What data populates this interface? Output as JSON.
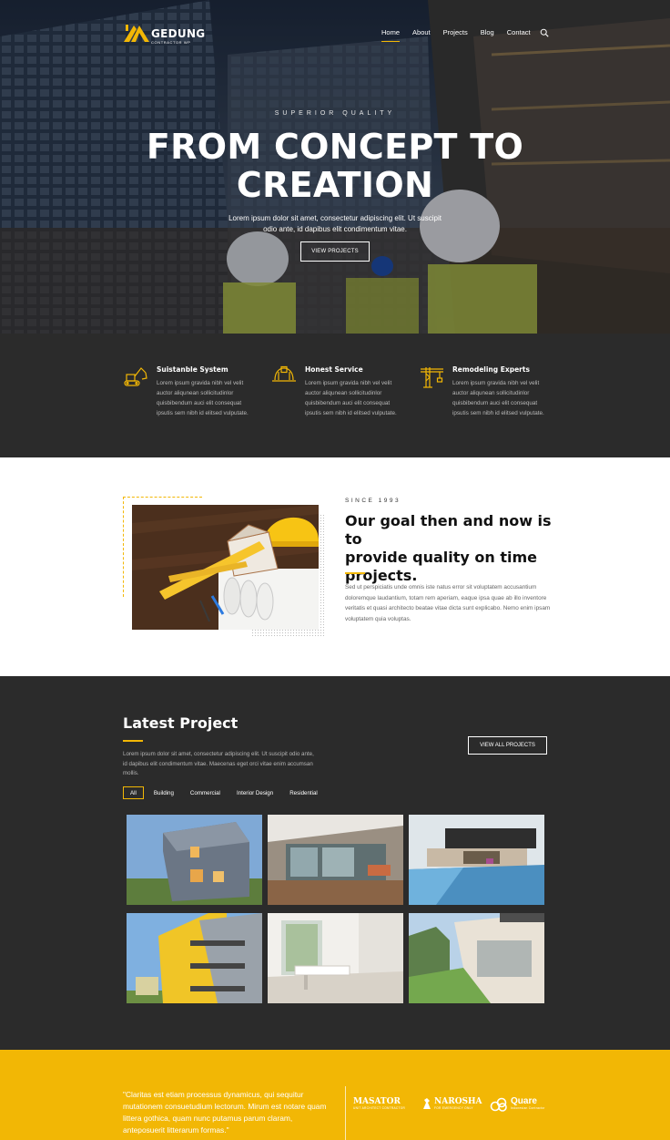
{
  "brand": {
    "name": "GEDUNG",
    "tagline": "CONTRACTOR WP",
    "accent_color": "#f2b705",
    "dark_color": "#2b2b2b"
  },
  "nav": {
    "items": [
      "Home",
      "About",
      "Projects",
      "Blog",
      "Contact"
    ],
    "active": "Home",
    "search_icon": "search-icon"
  },
  "hero": {
    "eyebrow": "SUPERIOR QUALITY",
    "headline_line1": "FROM CONCEPT TO",
    "headline_line2": "CREATION",
    "lead": "Lorem ipsum dolor sit amet, consectetur adipiscing elit. Ut suscipit odio ante, id dapibus elit condimentum vitae.",
    "button": "VIEW PROJECTS"
  },
  "features": [
    {
      "icon": "excavator-icon",
      "title": "Suistanble System",
      "text": "Lorem ipsum gravida nibh vel velit auctor aliqunean sollicitudinlor quisbibendum auci elit consequat ipsutis sem nibh id elitsed vulputate."
    },
    {
      "icon": "hard-hat-icon",
      "title": "Honest Service",
      "text": "Lorem ipsum gravida nibh vel velit auctor aliqunean sollicitudinlor quisbibendum auci elit consequat ipsutis sem nibh id elitsed vulputate."
    },
    {
      "icon": "crane-icon",
      "title": "Remodeling Experts",
      "text": "Lorem ipsum gravida nibh vel velit auctor aliqunean sollicitudinlor quisbibendum auci elit consequat ipsutis sem nibh id elitsed vulputate."
    }
  ],
  "about": {
    "since": "SINCE 1993",
    "title_line1": "Our goal then and now is to",
    "title_line2": "provide quality on time",
    "title_line3": "projects.",
    "text": "Sed ut perspiciatis unde omnis iste natus error sit voluptatem accusantium doloremque laudantium, totam rem aperiam, eaque ipsa quae ab illo inventore veritatis et quasi architecto beatae vitae dicta sunt explicabo. Nemo enim ipsam voluptatem quia voluptas."
  },
  "projects": {
    "title": "Latest Project",
    "description": "Lorem ipsum dolor sit amet, consectetur adipiscing elit. Ut suscipit odio ante, id dapibus elit condimentum vitae. Maecenas eget orci vitae enim accumsan mollis.",
    "view_all": "VIEW ALL PROJECTS",
    "filters": [
      "All",
      "Building",
      "Commercial",
      "Interior Design",
      "Residential"
    ],
    "active_filter": "All"
  },
  "testimonial": {
    "quote": "\"Claritas est etiam processus dynamicus, qui sequitur mutationem consuetudium lectorum. Mirum est notare quam littera gothica, quam nunc putamus parum claram, anteposuerit litterarum formas.\"",
    "partners": [
      {
        "name": "MASATOR",
        "sub": "UNIT ARCHITECT CONTRACTOR"
      },
      {
        "name": "NAROSHA",
        "sub": "FOR EMERGENCY ONLY"
      },
      {
        "name": "Quare",
        "sub": "Indonesian Contractor"
      }
    ]
  }
}
